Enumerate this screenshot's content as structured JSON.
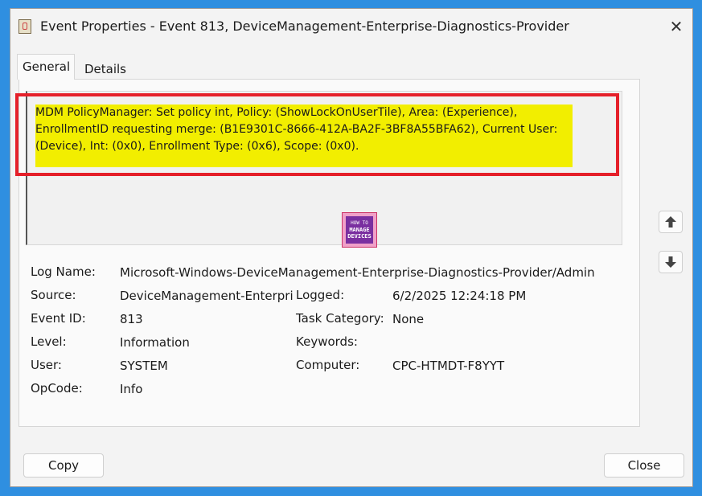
{
  "window": {
    "title": "Event Properties - Event 813, DeviceManagement-Enterprise-Diagnostics-Provider",
    "close_glyph": "✕"
  },
  "tabs": [
    {
      "label": "General",
      "active": true
    },
    {
      "label": "Details",
      "active": false
    }
  ],
  "description": "MDM PolicyManager: Set policy int, Policy: (ShowLockOnUserTile), Area: (Experience), EnrollmentID requesting merge: (B1E9301C-8666-412A-BA2F-3BF8A55BFA62), Current User: (Device), Int: (0x0), Enrollment Type: (0x6), Scope: (0x0).",
  "logo": {
    "line1": "HOW TO",
    "line2": "MANAGE",
    "line3": "DEVICES"
  },
  "fields": {
    "log_name_label": "Log Name:",
    "log_name_value": "Microsoft-Windows-DeviceManagement-Enterprise-Diagnostics-Provider/Admin",
    "source_label": "Source:",
    "source_value": "DeviceManagement-Enterpri",
    "logged_label": "Logged:",
    "logged_value": "6/2/2025 12:24:18 PM",
    "event_id_label": "Event ID:",
    "event_id_value": "813",
    "task_category_label": "Task Category:",
    "task_category_value": "None",
    "level_label": "Level:",
    "level_value": "Information",
    "keywords_label": "Keywords:",
    "keywords_value": "",
    "user_label": "User:",
    "user_value": "SYSTEM",
    "computer_label": "Computer:",
    "computer_value": "CPC-HTMDT-F8YYT",
    "opcode_label": "OpCode:",
    "opcode_value": "Info"
  },
  "buttons": {
    "copy": "Copy",
    "close": "Close"
  },
  "colors": {
    "background": "#2f8fe0",
    "highlight": "#f2ee00",
    "annotation_frame": "#e5202a"
  }
}
